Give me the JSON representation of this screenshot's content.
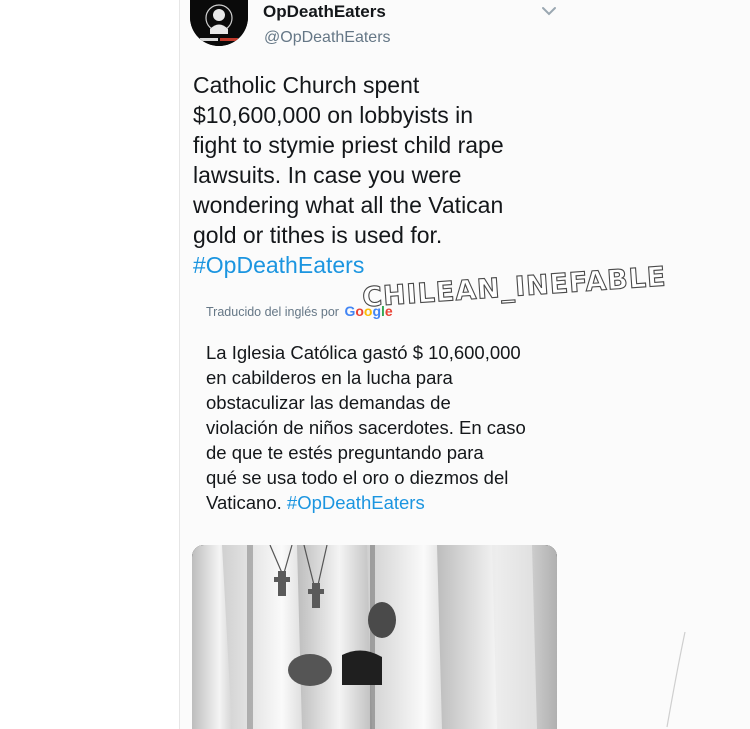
{
  "tweet": {
    "display_name": "OpDeathEaters",
    "handle": "@OpDeathEaters",
    "text_lines": [
      "Catholic Church spent",
      "$10,600,000 on lobbyists in",
      "fight to stymie priest child rape",
      "lawsuits. In case you were",
      "wondering what all the Vatican",
      "gold or tithes is used for."
    ],
    "hashtag": "#OpDeathEaters",
    "avatar_icon": "anonymous-mask-icon",
    "menu_icon": "chevron-down-icon"
  },
  "translation": {
    "label": "Traducido del inglés por",
    "provider": "Google",
    "lines": [
      "La Iglesia Católica gastó $ 10,600,000",
      "en cabilderos en la lucha para",
      "obstaculizar las demandas de",
      "violación de niños sacerdotes. En caso",
      "de que te estés preguntando para",
      "qué se usa todo el oro o diezmos del",
      "Vaticano."
    ],
    "hashtag": "#OpDeathEaters"
  },
  "watermark": "CHILEAN_INEFABLE",
  "colors": {
    "hashtag": "#1b95e0",
    "secondary_text": "#657786",
    "primary_text": "#14171a"
  }
}
